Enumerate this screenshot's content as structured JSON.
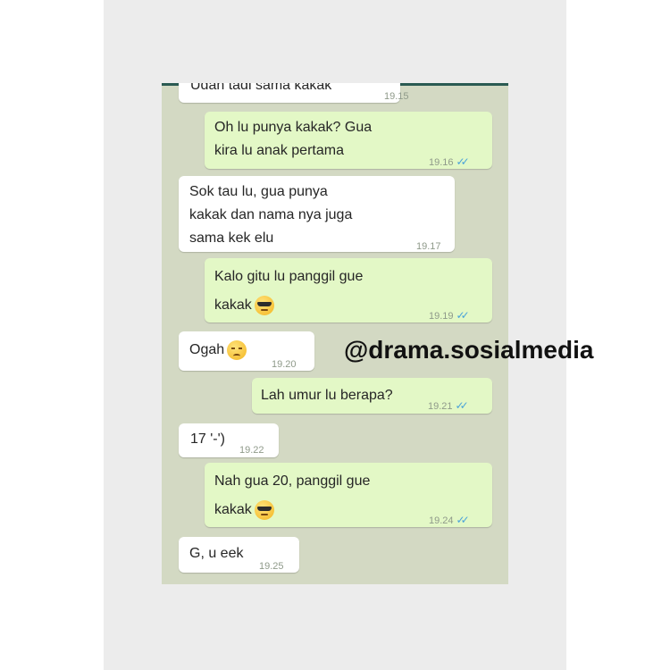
{
  "watermark": "@drama.sosialmedia",
  "colors": {
    "incoming_bubble": "#ffffff",
    "outgoing_bubble": "#e3f8c6",
    "chat_background": "#d3d9c3",
    "read_ticks": "#4aa3d9"
  },
  "messages": [
    {
      "direction": "incoming",
      "text": "Udah tadi sama kakak",
      "time": "19.15"
    },
    {
      "direction": "outgoing",
      "text": "Oh lu punya kakak? Gua\nkira lu anak pertama",
      "time": "19.16",
      "ticks": "✓✓"
    },
    {
      "direction": "incoming",
      "text": "Sok tau lu, gua punya\nkakak dan nama nya juga\nsama kek elu",
      "time": "19.17"
    },
    {
      "direction": "outgoing",
      "text": "Kalo gitu lu panggil gue\nkakak",
      "emoji": "smiling-face-with-sunglasses",
      "time": "19.19",
      "ticks": "✓✓"
    },
    {
      "direction": "incoming",
      "text": "Ogah",
      "emoji": "pensive-face",
      "time": "19.20"
    },
    {
      "direction": "outgoing",
      "text": "Lah umur lu berapa?",
      "time": "19.21",
      "ticks": "✓✓"
    },
    {
      "direction": "incoming",
      "text": "17 '-')",
      "time": "19.22"
    },
    {
      "direction": "outgoing",
      "text": "Nah gua 20, panggil gue\nkakak",
      "emoji": "smiling-face-with-sunglasses",
      "time": "19.24",
      "ticks": "✓✓"
    },
    {
      "direction": "incoming",
      "text": "G, u eek",
      "time": "19.25"
    }
  ]
}
